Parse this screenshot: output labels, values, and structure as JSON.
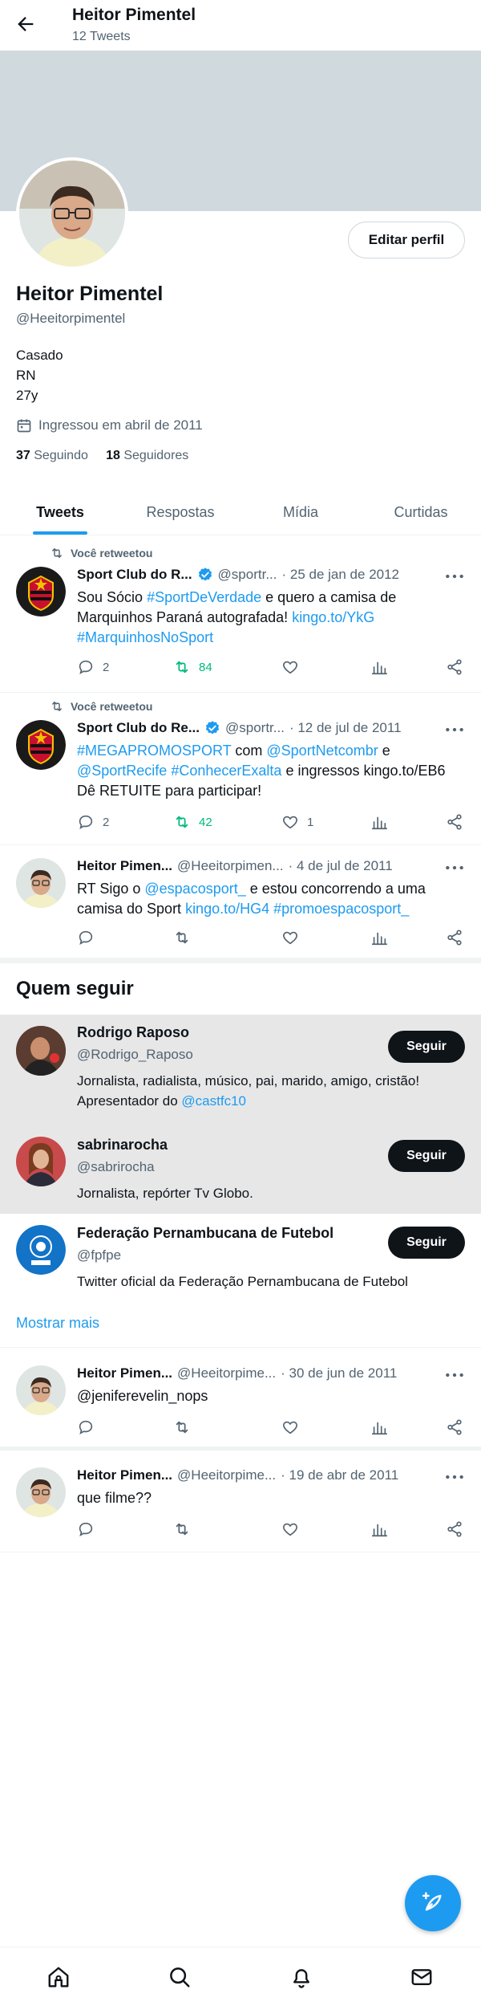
{
  "header": {
    "name": "Heitor Pimentel",
    "tweet_count": "12 Tweets"
  },
  "profile": {
    "edit_label": "Editar perfil",
    "name": "Heitor Pimentel",
    "handle": "@Heeitorpimentel",
    "bio_lines": [
      "Casado",
      "RN",
      "27y"
    ],
    "joined": "Ingressou em abril de 2011",
    "following_count": "37",
    "following_label": "Seguindo",
    "followers_count": "18",
    "followers_label": "Seguidores"
  },
  "tabs": [
    "Tweets",
    "Respostas",
    "Mídia",
    "Curtidas"
  ],
  "tweets": [
    {
      "retweet_label": "Você retweetou",
      "name": "Sport Club do R...",
      "handle": "@sportr...",
      "date": "· 25 de jan de 2012",
      "text_parts": [
        "Sou Sócio ",
        "#SportDeVerdade",
        " e quero a camisa de Marquinhos Paraná autografada! ",
        "kingo.to/YkG",
        " ",
        "#MarquinhosNoSport"
      ],
      "replies": "2",
      "retweets": "84",
      "likes": ""
    },
    {
      "retweet_label": "Você retweetou",
      "name": "Sport Club do Re...",
      "handle": "@sportr...",
      "date": "· 12 de jul de 2011",
      "text_parts": [
        "#MEGAPROMOSPORT",
        " com ",
        "@SportNetcombr",
        " e ",
        "@SportRecife",
        " ",
        "#ConhecerExalta",
        " e ingressos kingo.to/EB6 Dê RETUITE para participar!"
      ],
      "replies": "2",
      "retweets": "42",
      "likes": "1"
    },
    {
      "name": "Heitor Pimen...",
      "handle": "@Heeitorpimen...",
      "date": "· 4 de jul de 2011",
      "text_parts": [
        "RT Sigo o ",
        "@espacosport_",
        " e estou concorrendo a uma camisa do Sport ",
        "kingo.to/HG4",
        " ",
        "#promoespacosport_"
      ]
    },
    {
      "name": "Heitor Pimen...",
      "handle": "@Heeitorpime...",
      "date": "· 30 de jun de 2011",
      "text": "@jeniferevelin_nops"
    },
    {
      "name": "Heitor Pimen...",
      "handle": "@Heeitorpime...",
      "date": "· 19 de abr de 2011",
      "text": "que filme??"
    }
  ],
  "who_to_follow": {
    "title": "Quem seguir",
    "follow_label": "Seguir",
    "show_more": "Mostrar mais",
    "accounts": [
      {
        "name": "Rodrigo Raposo",
        "handle": "@Rodrigo_Raposo",
        "bio_parts": [
          "Jornalista, radialista, músico, pai, marido, amigo, cristão! Apresentador do ",
          "@castfc10"
        ]
      },
      {
        "name": "sabrinarocha",
        "handle": "@sabrirocha",
        "bio": "Jornalista, repórter Tv Globo."
      },
      {
        "name": "Federação Pernambucana de Futebol",
        "handle": "@fpfpe",
        "bio": "Twitter oficial da Federação Pernambucana de Futebol"
      }
    ]
  },
  "colors": {
    "accent": "#1d9bf0",
    "retweet_green": "#00ba7c",
    "text": "#0f1419",
    "muted": "#536471",
    "banner": "#cfd9de"
  },
  "icons": [
    "back-arrow-icon",
    "calendar-icon",
    "retweet-icon",
    "verified-icon",
    "more-icon",
    "reply-icon",
    "like-icon",
    "views-icon",
    "share-icon",
    "compose-icon",
    "home-icon",
    "search-icon",
    "notifications-icon",
    "messages-icon"
  ]
}
